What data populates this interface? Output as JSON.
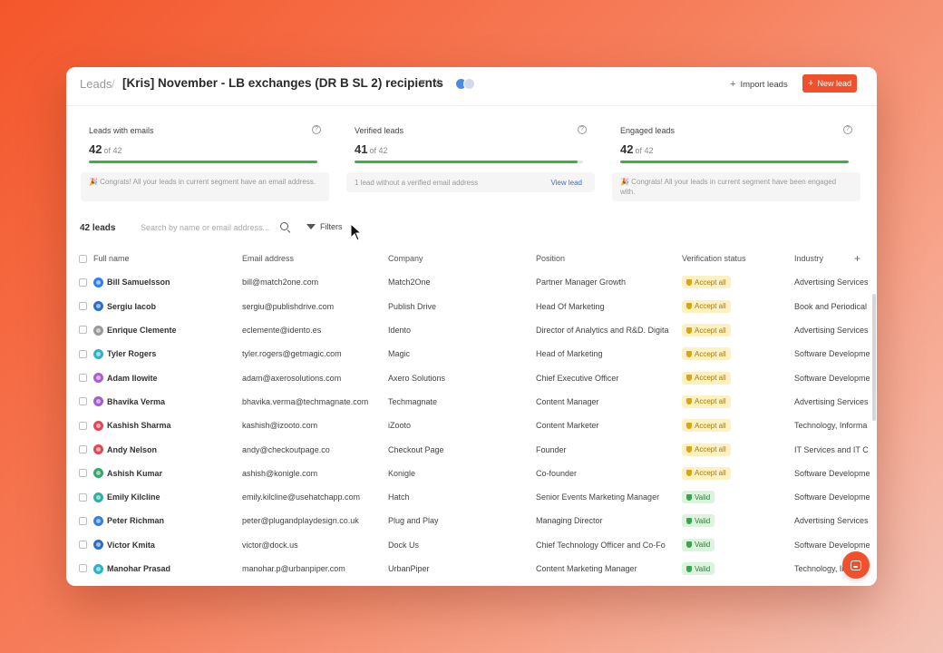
{
  "header": {
    "breadcrumb_root": "Leads",
    "breadcrumb_sep": "/",
    "title": "[Kris] November - LB exchanges (DR B SL 2) recipients",
    "import_label": "Import leads",
    "new_label": "New lead"
  },
  "stats": [
    {
      "label": "Leads with emails",
      "value": "42",
      "of": "of 42",
      "progress": 1.0,
      "note": "🎉 Congrats! All your leads in current segment have an email address.",
      "link": ""
    },
    {
      "label": "Verified leads",
      "value": "41",
      "of": "of 42",
      "progress": 0.976,
      "note": "1 lead without a verified email address",
      "link": "View lead"
    },
    {
      "label": "Engaged leads",
      "value": "42",
      "of": "of 42",
      "progress": 1.0,
      "note": "🎉 Congrats! All your leads in current segment have been engaged with.",
      "link": ""
    }
  ],
  "toolbar": {
    "count": "42 leads",
    "search_placeholder": "Search by name or email address...",
    "filters_label": "Filters"
  },
  "table": {
    "columns": [
      "Full name",
      "Email address",
      "Company",
      "Position",
      "Verification status",
      "Industry"
    ],
    "rows": [
      {
        "name": "Bill Samuelsson",
        "email": "bill@match2one.com",
        "company": "Match2One",
        "position": "Partner Manager Growth",
        "status": "Accept all",
        "industry": "Advertising Services",
        "avatar_color": "#2f80ed"
      },
      {
        "name": "Sergiu Iacob",
        "email": "sergiu@publishdrive.com",
        "company": "Publish Drive",
        "position": "Head Of Marketing",
        "status": "Accept all",
        "industry": "Book and Periodical",
        "avatar_color": "#2d6fc7"
      },
      {
        "name": "Enrique Clemente",
        "email": "eclemente@idento.es",
        "company": "Idento",
        "position": "Director of Analytics and R&D. Digita",
        "status": "Accept all",
        "industry": "Advertising Services",
        "avatar_color": "#9a9a9a"
      },
      {
        "name": "Tyler Rogers",
        "email": "tyler.rogers@getmagic.com",
        "company": "Magic",
        "position": "Head of Marketing",
        "status": "Accept all",
        "industry": "Software Developme",
        "avatar_color": "#2bb3c9"
      },
      {
        "name": "Adam Ilowite",
        "email": "adam@axerosolutions.com",
        "company": "Axero Solutions",
        "position": "Chief Executive Officer",
        "status": "Accept all",
        "industry": "Software Developme",
        "avatar_color": "#b25ad6"
      },
      {
        "name": "Bhavika Verma",
        "email": "bhavika.verma@techmagnate.com",
        "company": "Techmagnate",
        "position": "Content Manager",
        "status": "Accept all",
        "industry": "Advertising Services",
        "avatar_color": "#a55bd8"
      },
      {
        "name": "Kashish Sharma",
        "email": "kashish@izooto.com",
        "company": "iZooto",
        "position": "Content Marketer",
        "status": "Accept all",
        "industry": "Technology, Informa",
        "avatar_color": "#e0485a"
      },
      {
        "name": "Andy Nelson",
        "email": "andy@checkoutpage.co",
        "company": "Checkout Page",
        "position": "Founder",
        "status": "Accept all",
        "industry": "IT Services and IT C",
        "avatar_color": "#e0485a"
      },
      {
        "name": "Ashish Kumar",
        "email": "ashish@konigle.com",
        "company": "Konigle",
        "position": "Co-founder",
        "status": "Accept all",
        "industry": "Software Developme",
        "avatar_color": "#35a86a"
      },
      {
        "name": "Emily Kilcline",
        "email": "emily.kilcline@usehatchapp.com",
        "company": "Hatch",
        "position": "Senior Events Marketing Manager",
        "status": "Valid",
        "industry": "Software Developme",
        "avatar_color": "#2bb3a3"
      },
      {
        "name": "Peter Richman",
        "email": "peter@plugandplaydesign.co.uk",
        "company": "Plug and Play",
        "position": "Managing Director",
        "status": "Valid",
        "industry": "Advertising Services",
        "avatar_color": "#2f80ed"
      },
      {
        "name": "Victor Kmita",
        "email": "victor@dock.us",
        "company": "Dock Us",
        "position": "Chief Technology Officer and Co-Fo",
        "status": "Valid",
        "industry": "Software Developme",
        "avatar_color": "#2d6fc7"
      },
      {
        "name": "Manohar Prasad",
        "email": "manohar.p@urbanpiper.com",
        "company": "UrbanPiper",
        "position": "Content Marketing Manager",
        "status": "Valid",
        "industry": "Technology, Informa",
        "avatar_color": "#2bb3c9"
      }
    ]
  },
  "colors": {
    "accent": "#f0502c",
    "progress": "#3cb043",
    "accept_badge_bg": "#fdf1c2",
    "valid_badge_bg": "#dcf4de"
  }
}
